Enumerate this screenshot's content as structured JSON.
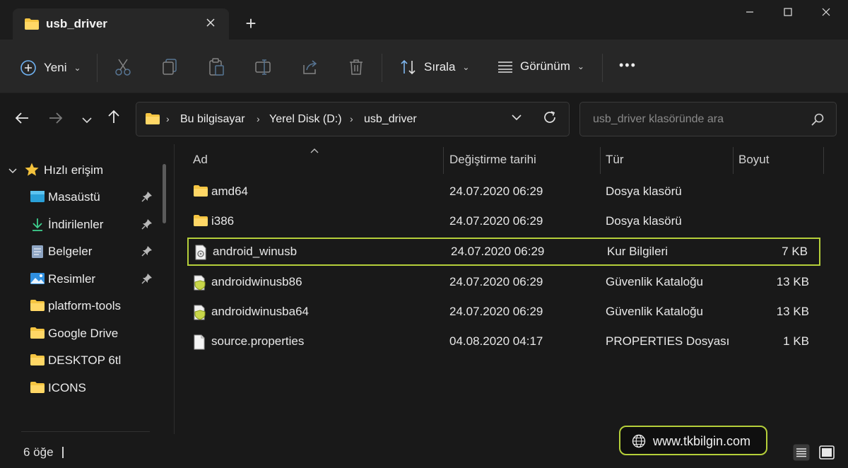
{
  "tab": {
    "title": "usb_driver",
    "close_icon": "close-icon",
    "new_tab": "+"
  },
  "window_controls": [
    "minimize",
    "maximize",
    "close"
  ],
  "toolbar": {
    "new_label": "Yeni",
    "sort_label": "Sırala",
    "view_label": "Görünüm",
    "more_label": "•••",
    "icons": [
      "cut-icon",
      "copy-icon",
      "paste-icon",
      "rename-icon",
      "share-icon",
      "delete-icon"
    ]
  },
  "address": {
    "crumbs": [
      "Bu bilgisayar",
      "Yerel Disk (D:)",
      "usb_driver"
    ],
    "separator": "›"
  },
  "search": {
    "placeholder": "usb_driver klasöründe ara"
  },
  "sidebar": {
    "quick_access": "Hızlı erişim",
    "items": [
      {
        "label": "Masaüstü",
        "icon": "desktop-icon",
        "pinned": true
      },
      {
        "label": "İndirilenler",
        "icon": "download-icon",
        "pinned": true
      },
      {
        "label": "Belgeler",
        "icon": "documents-icon",
        "pinned": true
      },
      {
        "label": "Resimler",
        "icon": "pictures-icon",
        "pinned": true
      },
      {
        "label": "platform-tools",
        "icon": "folder-icon",
        "pinned": false
      },
      {
        "label": "Google Drive",
        "icon": "folder-icon",
        "pinned": false
      },
      {
        "label": "DESKTOP 6tl",
        "icon": "folder-icon",
        "pinned": false
      },
      {
        "label": "ICONS",
        "icon": "folder-icon",
        "pinned": false
      }
    ]
  },
  "columns": {
    "name": "Ad",
    "date": "Değiştirme tarihi",
    "type": "Tür",
    "size": "Boyut"
  },
  "files": [
    {
      "name": "amd64",
      "date": "24.07.2020 06:29",
      "type": "Dosya klasörü",
      "size": "",
      "icon": "folder-icon"
    },
    {
      "name": "i386",
      "date": "24.07.2020 06:29",
      "type": "Dosya klasörü",
      "size": "",
      "icon": "folder-icon"
    },
    {
      "name": "android_winusb",
      "date": "24.07.2020 06:29",
      "type": "Kur Bilgileri",
      "size": "7 KB",
      "icon": "setup-info-icon"
    },
    {
      "name": "androidwinusb86",
      "date": "24.07.2020 06:29",
      "type": "Güvenlik Kataloğu",
      "size": "13 KB",
      "icon": "security-catalog-icon"
    },
    {
      "name": "androidwinusba64",
      "date": "24.07.2020 06:29",
      "type": "Güvenlik Kataloğu",
      "size": "13 KB",
      "icon": "security-catalog-icon"
    },
    {
      "name": "source.properties",
      "date": "04.08.2020 04:17",
      "type": "PROPERTIES Dosyası",
      "size": "1 KB",
      "icon": "file-icon"
    }
  ],
  "selected_file": "android_winusb",
  "status": {
    "count": "6 öğe"
  },
  "watermark": {
    "text": "www.tkbilgin.com"
  },
  "colors": {
    "highlight": "#b5cf3a",
    "folder": "#f5c542",
    "background": "#191919"
  }
}
